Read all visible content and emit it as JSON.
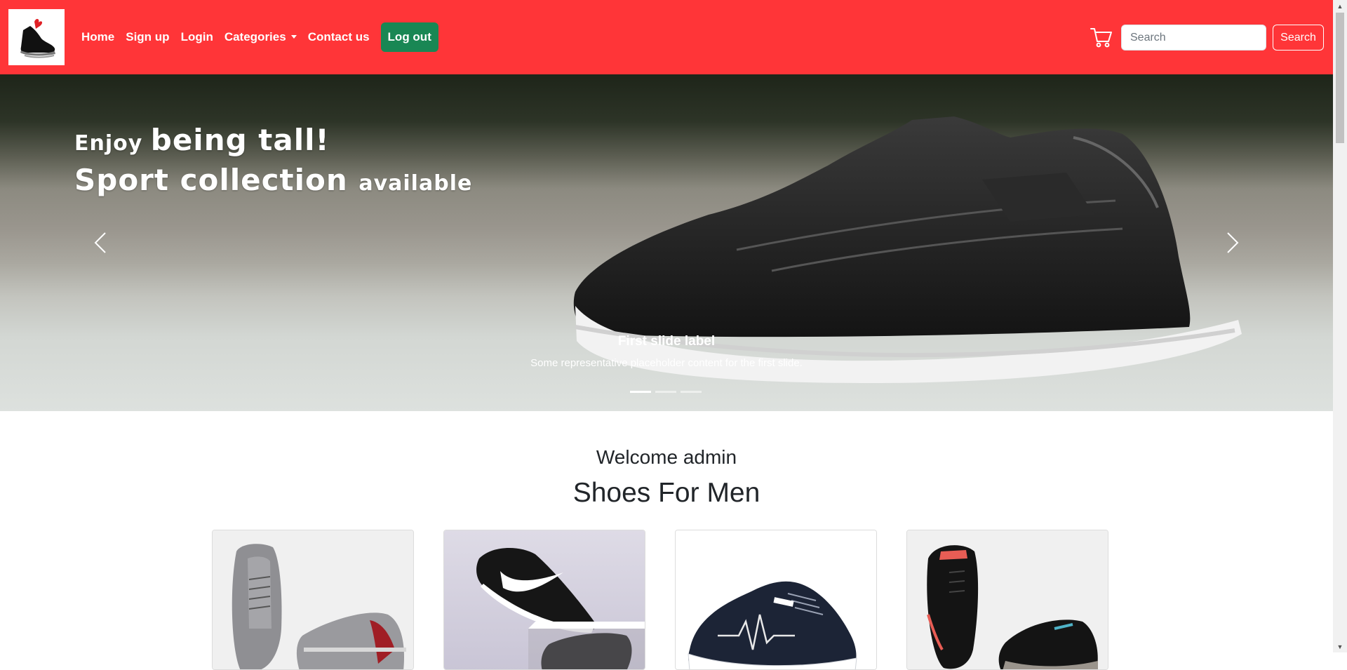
{
  "nav": {
    "links": [
      {
        "label": "Home"
      },
      {
        "label": "Sign up"
      },
      {
        "label": "Login"
      },
      {
        "label": "Categories"
      },
      {
        "label": "Contact us"
      }
    ],
    "logout_label": "Log out",
    "search_placeholder": "Search",
    "search_button_label": "Search",
    "colors": {
      "navbar": "#ff3538",
      "logout": "#198754"
    }
  },
  "carousel": {
    "headline_line1_small": "Enjoy ",
    "headline_line1_large": "being tall!",
    "headline_line2_large": "Sport collection ",
    "headline_line2_small": "available",
    "caption_title": "First slide label",
    "caption_text": "Some representative placeholder content for the first slide.",
    "slide_count": 3,
    "active_slide": 1
  },
  "content": {
    "welcome": "Welcome admin",
    "section_title": "Shoes For Men",
    "products": [
      {
        "image": "grey-sneakers-image"
      },
      {
        "image": "black-running-shoes-image"
      },
      {
        "image": "navy-sneaker-image"
      },
      {
        "image": "black-sport-shoes-image"
      }
    ]
  },
  "icons": {
    "logo": "shoe-logo-icon",
    "cart": "cart-icon",
    "prev": "chevron-left-icon",
    "next": "chevron-right-icon"
  }
}
